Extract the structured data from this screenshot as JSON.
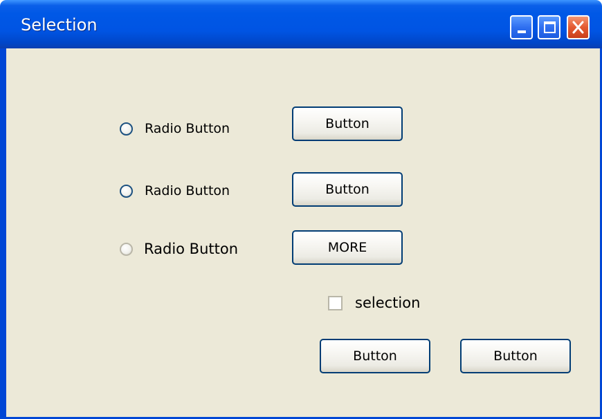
{
  "window": {
    "title": "Selection"
  },
  "title_buttons": {
    "minimize_icon": "minimize-icon",
    "maximize_icon": "maximize-icon",
    "close_icon": "close-icon"
  },
  "radios": [
    {
      "label": "Radio Button",
      "enabled": true,
      "selected": false
    },
    {
      "label": "Radio Button",
      "enabled": true,
      "selected": false
    },
    {
      "label": "Radio Button",
      "enabled": false,
      "selected": false
    }
  ],
  "buttons": {
    "row1": "Button",
    "row2": "Button",
    "more": "MORE",
    "bottom_left": "Button",
    "bottom_right": "Button"
  },
  "checkbox": {
    "label": "selection",
    "checked": false
  },
  "colors": {
    "titlebar": "#0054e3",
    "client_bg": "#ece9d8",
    "button_border": "#003c74",
    "close_button": "#e45a31"
  }
}
